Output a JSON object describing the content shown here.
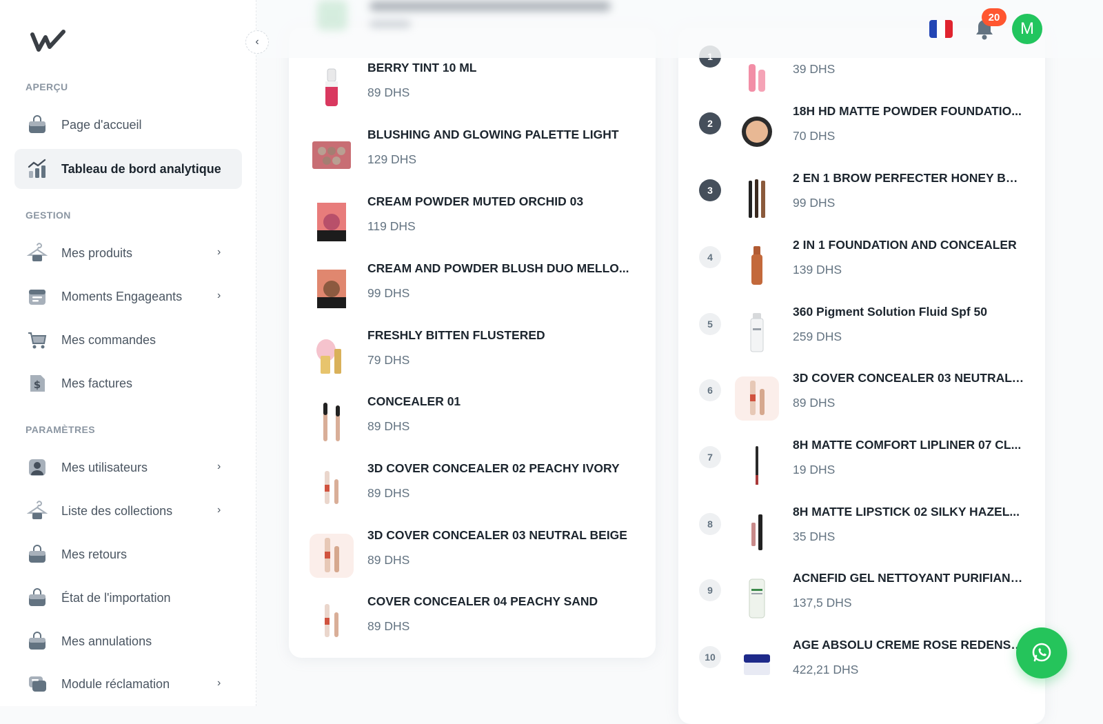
{
  "sidebar": {
    "sections": {
      "apercu": "APERÇU",
      "gestion": "GESTION",
      "parametres": "PARAMÈTRES"
    },
    "items": [
      {
        "label": "Page d'accueil",
        "icon": "bag-icon",
        "chevron": false
      },
      {
        "label": "Tableau de bord analytique",
        "icon": "analytics-icon",
        "chevron": false,
        "active": true
      },
      {
        "label": "Mes produits",
        "icon": "hanger-icon",
        "chevron": true
      },
      {
        "label": "Moments Engageants",
        "icon": "calendar-icon",
        "chevron": true
      },
      {
        "label": "Mes commandes",
        "icon": "cart-icon",
        "chevron": false
      },
      {
        "label": "Mes factures",
        "icon": "invoice-icon",
        "chevron": false
      },
      {
        "label": "Mes utilisateurs",
        "icon": "user-icon",
        "chevron": true
      },
      {
        "label": "Liste des collections",
        "icon": "hanger-icon",
        "chevron": true
      },
      {
        "label": "Mes retours",
        "icon": "bag-icon",
        "chevron": false
      },
      {
        "label": "État de l'importation",
        "icon": "bag-icon",
        "chevron": false
      },
      {
        "label": "Mes annulations",
        "icon": "bag-icon",
        "chevron": false
      },
      {
        "label": "Module réclamation",
        "icon": "chat-icon",
        "chevron": true
      }
    ]
  },
  "header": {
    "notification_count": "20",
    "avatar_initial": "M",
    "flag": "france-flag-icon"
  },
  "left_list": [
    {
      "name": "BERRY TINT 10 ML",
      "price": "89 DHS"
    },
    {
      "name": "BLUSHING AND GLOWING PALETTE LIGHT",
      "price": "129 DHS"
    },
    {
      "name": "CREAM POWDER MUTED ORCHID 03",
      "price": "119 DHS"
    },
    {
      "name": "CREAM AND POWDER BLUSH DUO MELLO...",
      "price": "99 DHS"
    },
    {
      "name": "FRESHLY BITTEN FLUSTERED",
      "price": "79 DHS"
    },
    {
      "name": "CONCEALER 01",
      "price": "89 DHS"
    },
    {
      "name": "3D COVER CONCEALER 02 PEACHY IVORY",
      "price": "89 DHS"
    },
    {
      "name": "3D COVER CONCEALER 03 NEUTRAL BEIGE",
      "price": "89 DHS"
    },
    {
      "name": "COVER CONCEALER 04 PEACHY SAND",
      "price": "89 DHS"
    }
  ],
  "right_list": [
    {
      "rank": "1",
      "name": "",
      "price": "39 DHS"
    },
    {
      "rank": "2",
      "name": "18H HD MATTE POWDER FOUNDATIO...",
      "price": "70 DHS"
    },
    {
      "rank": "3",
      "name": "2 EN 1 BROW PERFECTER HONEY BRO...",
      "price": "99 DHS"
    },
    {
      "rank": "4",
      "name": "2 IN 1 FOUNDATION AND CONCEALER",
      "price": "139 DHS"
    },
    {
      "rank": "5",
      "name": "360 Pigment Solution Fluid Spf 50",
      "price": "259 DHS"
    },
    {
      "rank": "6",
      "name": "3D COVER CONCEALER 03 NEUTRAL ...",
      "price": "89 DHS"
    },
    {
      "rank": "7",
      "name": "8H MATTE COMFORT LIPLINER 07 CL...",
      "price": "19 DHS"
    },
    {
      "rank": "8",
      "name": "8H MATTE LIPSTICK 02 SILKY HAZEL...",
      "price": "35 DHS"
    },
    {
      "rank": "9",
      "name": "ACNEFID GEL NETTOYANT PURIFIANT...",
      "price": "137,5 DHS"
    },
    {
      "rank": "10",
      "name": "AGE ABSOLU CREME ROSE REDENSIF...",
      "price": "422,21 DHS"
    }
  ],
  "colors": {
    "accent_green": "#22c55e",
    "whatsapp_green": "#25c45b",
    "badge_red": "#ff5630",
    "rank_dark": "#454f5b"
  }
}
